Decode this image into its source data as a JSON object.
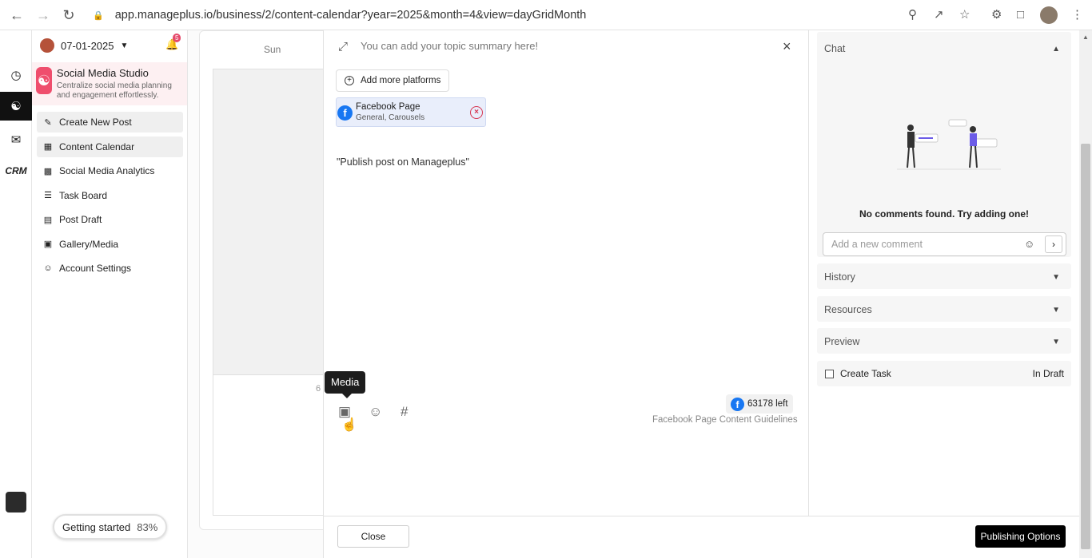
{
  "browser": {
    "url": "app.manageplus.io/business/2/content-calendar?year=2025&month=4&view=dayGridMonth"
  },
  "sidebar": {
    "date": "07-01-2025",
    "notification_count": "5",
    "studio_title": "Social Media Studio",
    "studio_desc": "Centralize social media planning and engagement effortlessly.",
    "items": [
      {
        "label": "Create New Post",
        "icon": "edit-icon"
      },
      {
        "label": "Content Calendar",
        "icon": "calendar-icon"
      },
      {
        "label": "Social Media Analytics",
        "icon": "bar-chart-icon"
      },
      {
        "label": "Task Board",
        "icon": "list-icon"
      },
      {
        "label": "Post Draft",
        "icon": "document-icon"
      },
      {
        "label": "Gallery/Media",
        "icon": "image-icon"
      },
      {
        "label": "Account Settings",
        "icon": "user-icon"
      }
    ],
    "getting_started": "Getting started",
    "getting_started_pct": "83%"
  },
  "rail": {
    "crm_label": "CRM"
  },
  "calendar": {
    "day_header": "Sun",
    "day_number": "6"
  },
  "editor": {
    "summary_placeholder": "You can add your topic summary here!",
    "add_platforms": "Add more platforms",
    "platform": {
      "name": "Facebook Page",
      "sub": "General, Carousels"
    },
    "post_text": "\"Publish post on Manageplus\"",
    "tooltip": "Media",
    "chars_left": "63178 left",
    "guidelines": "Facebook Page Content Guidelines",
    "close_label": "Close",
    "publish_label": "Publishing Options"
  },
  "right_panel": {
    "chat_title": "Chat",
    "no_comments": "No comments found. Try adding one!",
    "comment_placeholder": "Add a new comment",
    "history": "History",
    "resources": "Resources",
    "preview": "Preview",
    "create_task": "Create Task",
    "status": "In Draft"
  },
  "colors": {
    "brand": "#ef4e6d",
    "facebook": "#1877f2",
    "primary_button": "#000000"
  }
}
